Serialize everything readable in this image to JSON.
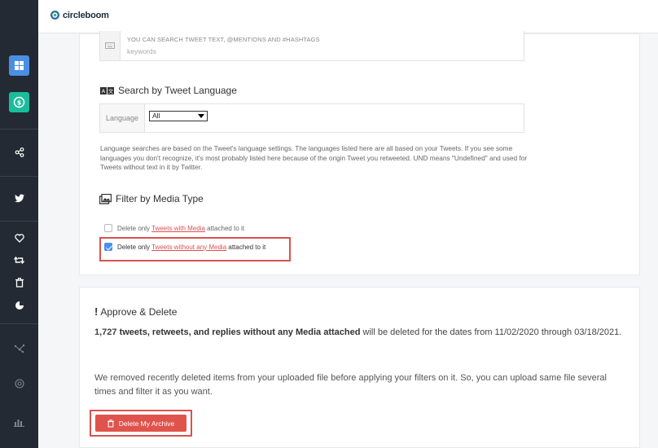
{
  "app": {
    "logo_text": "circleboom"
  },
  "sidebar": {
    "items": [
      {
        "icon": "dashboard-icon"
      },
      {
        "icon": "dollar-icon"
      },
      {
        "icon": "share-icon"
      },
      {
        "icon": "twitter-icon"
      },
      {
        "icon": "heart-icon"
      },
      {
        "icon": "retweet-icon"
      },
      {
        "icon": "trash-icon"
      },
      {
        "icon": "pie-icon"
      },
      {
        "icon": "network-icon"
      },
      {
        "icon": "target-icon"
      },
      {
        "icon": "bar-chart-icon"
      }
    ]
  },
  "keywords": {
    "hint": "YOU CAN SEARCH TWEET TEXT, @MENTIONS AND #HASHTAGS",
    "placeholder": "keywords"
  },
  "language": {
    "title": "Search by Tweet Language",
    "label": "Language",
    "selected": "All",
    "note": "Language searches are based on the Tweet's language settings. The languages listed here are all based on your Tweets. If you see some languages you don't recognize, it's most probably listed here because of the origin Tweet you retweeted. UND means \"Undefined\" and used for Tweets without text in it by Twitter."
  },
  "media": {
    "title": "Filter by Media Type",
    "option1": {
      "pre": "Delete only ",
      "link": "Tweets with Media",
      "post": " attached to it",
      "checked": false
    },
    "option2": {
      "pre": "Delete only ",
      "link": "Tweets without any Media",
      "post": " attached to it",
      "checked": true
    }
  },
  "approve": {
    "icon": "!",
    "title": "Approve & Delete",
    "count": "1,727",
    "bold_text": " tweets, retweets, and replies without any Media attached",
    "rest_text": " will be deleted for the dates from 11/02/2020 through 03/18/2021.",
    "note": "We removed recently deleted items from your uploaded file before applying your filters on it. So, you can upload same file several times and filter it as you want.",
    "button_label": "Delete My Archive"
  },
  "colors": {
    "accent": "#4a8ff0",
    "danger": "#e0534c",
    "sidebar": "#232a33",
    "teal": "#1abc9c"
  }
}
